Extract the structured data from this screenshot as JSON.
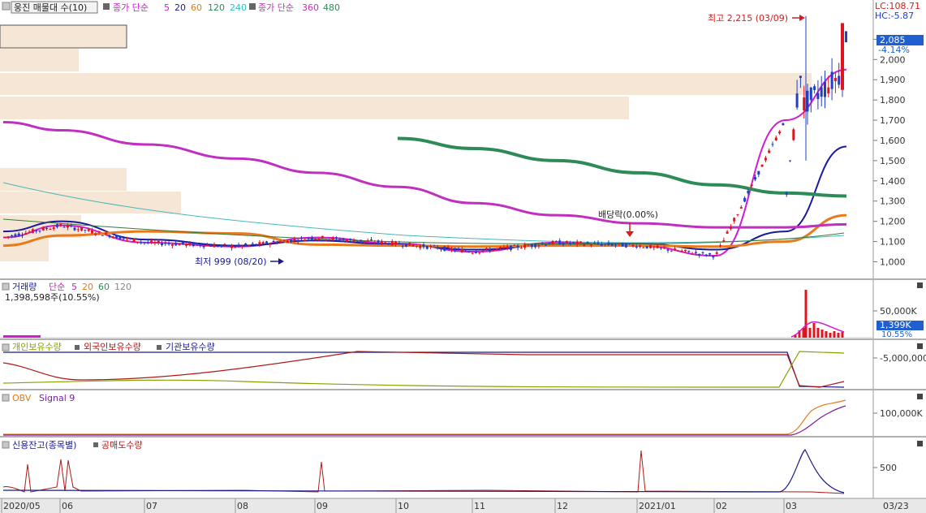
{
  "colors": {
    "price_up": "#e0141e",
    "price_down": "#1f3fc9",
    "ma5": "#d21ad2",
    "ma20": "#1a1aa0",
    "ma60": "#e87a1c",
    "ma120": "#48b8b8",
    "ma240": "#30c0c0",
    "ma360": "#c030c0",
    "ma480": "#2e8b57",
    "volume_profile": "#f5e6d6",
    "axis_bg": "#e8e8e8"
  },
  "header": {
    "title": "웅진 매물대 수(10)",
    "ma_group1": "종가 단순",
    "ma_periods1": [
      "5",
      "20",
      "60",
      "120",
      "240"
    ],
    "ma_group2": "종가 단순",
    "ma_periods2": [
      "360",
      "480"
    ]
  },
  "price_panel": {
    "lc": "LC:108.71",
    "hc": "HC:-5.87",
    "current_price": "2,085",
    "change_pct": "-4.14%",
    "y_ticks": [
      "2,100",
      "2,000",
      "1,900",
      "1,800",
      "1,700",
      "1,600",
      "1,500",
      "1,400",
      "1,300",
      "1,200",
      "1,100",
      "1,000"
    ],
    "high_label": "최고 2,215 (03/09)",
    "low_label": "최저 999 (08/20)",
    "dividend_label": "배당락(0.00%)"
  },
  "volume_panel": {
    "legend_title": "거래량",
    "legend_ma": "단순",
    "legend_periods": [
      "5",
      "20",
      "60",
      "120"
    ],
    "last_value": "1,398,598주(10.55%)",
    "y_tick": "50,000K",
    "current_value": "1,399K",
    "current_pct": "10.55%"
  },
  "holding_panel": {
    "legend": [
      "개인보유수량",
      "외국인보유수량",
      "기관보유수량"
    ],
    "y_tick": "-5,000,000"
  },
  "obv_panel": {
    "legend": [
      "OBV",
      "Signal 9"
    ],
    "y_tick": "100,000K"
  },
  "credit_panel": {
    "legend": [
      "신용잔고(종목별)",
      "공매도수량"
    ],
    "y_tick": "500"
  },
  "x_axis": {
    "labels": [
      "2020/05",
      "06",
      "07",
      "08",
      "09",
      "10",
      "11",
      "12",
      "2021/01",
      "02",
      "03"
    ],
    "right_label": "03/23"
  },
  "chart_data": {
    "type": "candlestick",
    "y_unit": "KRW",
    "ylim": [
      950,
      2230
    ],
    "moving_averages": [
      "5",
      "20",
      "60",
      "120",
      "240",
      "360",
      "480"
    ],
    "series": [
      {
        "name": "5",
        "x": [
          "2020/05",
          "06",
          "07",
          "08",
          "09",
          "10",
          "11",
          "12",
          "2021/01",
          "02",
          "03",
          "03/23"
        ],
        "values": [
          1120,
          1180,
          1095,
          1075,
          1120,
          1090,
          1050,
          1095,
          1080,
          1030,
          1700,
          1950
        ]
      },
      {
        "name": "20",
        "x": [
          "2020/05",
          "06",
          "07",
          "08",
          "09",
          "10",
          "11",
          "12",
          "2021/01",
          "02",
          "03",
          "03/23"
        ],
        "values": [
          1150,
          1200,
          1110,
          1080,
          1105,
          1085,
          1060,
          1085,
          1090,
          1060,
          1150,
          1570
        ]
      },
      {
        "name": "60",
        "x": [
          "2020/05",
          "06",
          "07",
          "08",
          "09",
          "10",
          "11",
          "12",
          "2021/01",
          "02",
          "03",
          "03/23"
        ],
        "values": [
          1080,
          1130,
          1150,
          1140,
          1085,
          1080,
          1075,
          1080,
          1080,
          1075,
          1100,
          1230
        ]
      },
      {
        "name": "360",
        "x": [
          "2020/05",
          "06",
          "07",
          "08",
          "09",
          "10",
          "11",
          "12",
          "2021/01",
          "02",
          "03",
          "03/23"
        ],
        "values": [
          1690,
          1650,
          1580,
          1510,
          1440,
          1370,
          1290,
          1230,
          1190,
          1170,
          1170,
          1185
        ]
      },
      {
        "name": "480",
        "x": [
          "10",
          "11",
          "12",
          "2021/01",
          "02",
          "03",
          "03/23"
        ],
        "values": [
          1610,
          1560,
          1500,
          1440,
          1380,
          1340,
          1325
        ]
      }
    ],
    "annotations": [
      {
        "label": "최고 2,215 (03/09)",
        "x": "03/09",
        "y": 2215
      },
      {
        "label": "최저 999 (08/20)",
        "x": "08/20",
        "y": 999
      },
      {
        "label": "배당락(0.00%)",
        "x": "2020/12",
        "y": 1140
      }
    ]
  }
}
